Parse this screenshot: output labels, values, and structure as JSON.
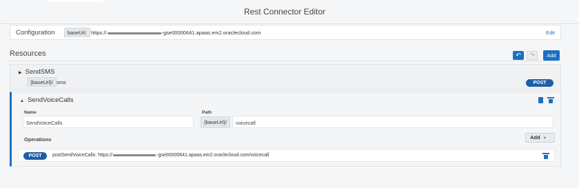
{
  "window": {
    "title": "Rest Connector Editor"
  },
  "configuration": {
    "label": "Configuration",
    "tag": "baseUrl:",
    "url_prefix": "https://",
    "url_suffix": "-gse00000641.apaas.em2.oraclecloud.com",
    "edit_label": "Edit"
  },
  "resources": {
    "header": "Resources",
    "undo_icon": "undo-icon",
    "redo_icon": "redo-icon",
    "add_label": "Add",
    "items": [
      {
        "name": "SendSMS",
        "expanded": false,
        "tag": "{baseUrl}/",
        "path": "sms",
        "method": "POST"
      },
      {
        "name": "SendVoiceCalls",
        "expanded": true,
        "name_label": "Name",
        "name_value": "SendVoiceCalls",
        "path_label": "Path",
        "tag": "{baseUrl}/",
        "path_value": "voicecall",
        "operations_label": "Operations",
        "add_label": "Add",
        "operations": [
          {
            "method": "POST",
            "name": "postSendVoiceCalls:",
            "url_prefix": "https://",
            "url_suffix": "-gse00000641.apaas.em2.oraclecloud.com/voicecall"
          }
        ]
      }
    ]
  },
  "colors": {
    "accent": "#1d6fc1",
    "badge": "#1d5fa8",
    "link": "#1a73c8"
  }
}
